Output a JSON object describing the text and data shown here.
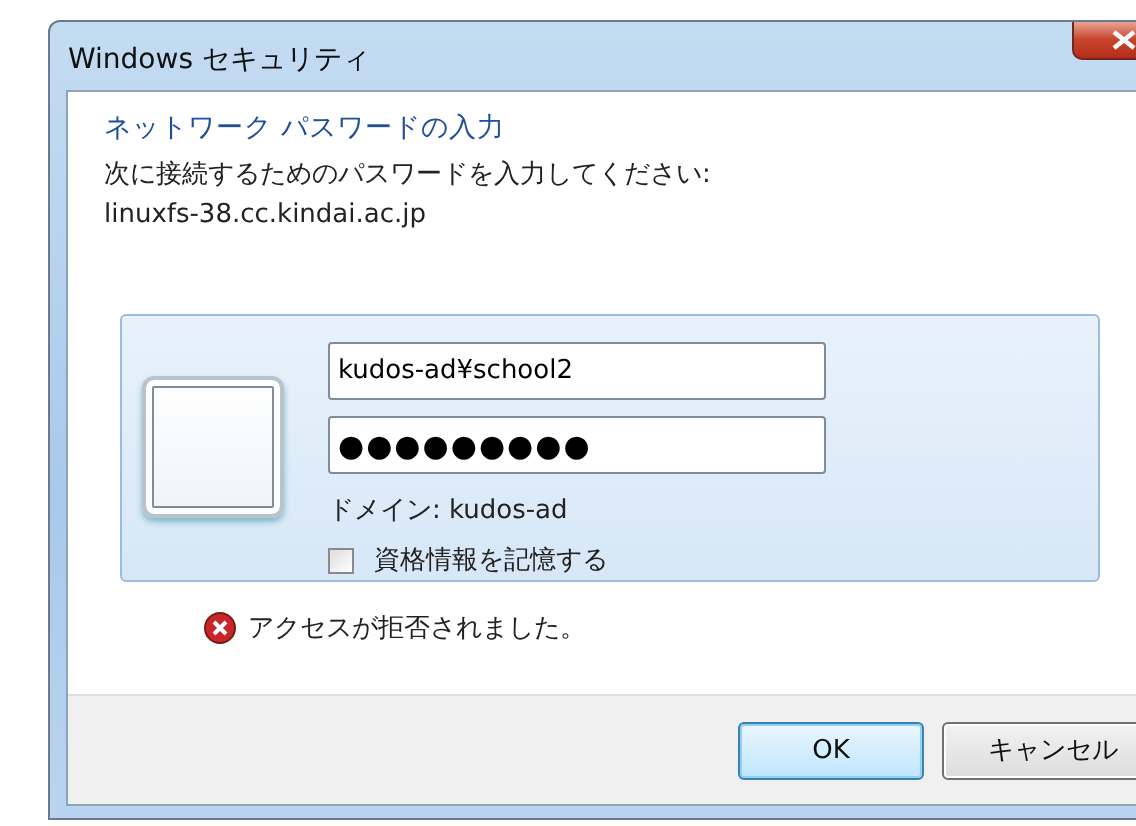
{
  "window": {
    "title": "Windows セキュリティ"
  },
  "heading": "ネットワーク パスワードの入力",
  "instruction": "次に接続するためのパスワードを入力してください:",
  "server": "linuxfs-38.cc.kindai.ac.jp",
  "credential": {
    "username": "kudos-ad¥school2",
    "password": "●●●●●●●●●",
    "domain": "ドメイン: kudos-ad",
    "remember": {
      "label": "資格情報を記憶する",
      "checked": false
    }
  },
  "error": "アクセスが拒否されました。",
  "buttons": [
    {
      "label": "OK",
      "default": true
    },
    {
      "label": "キャンセル",
      "default": false
    }
  ]
}
